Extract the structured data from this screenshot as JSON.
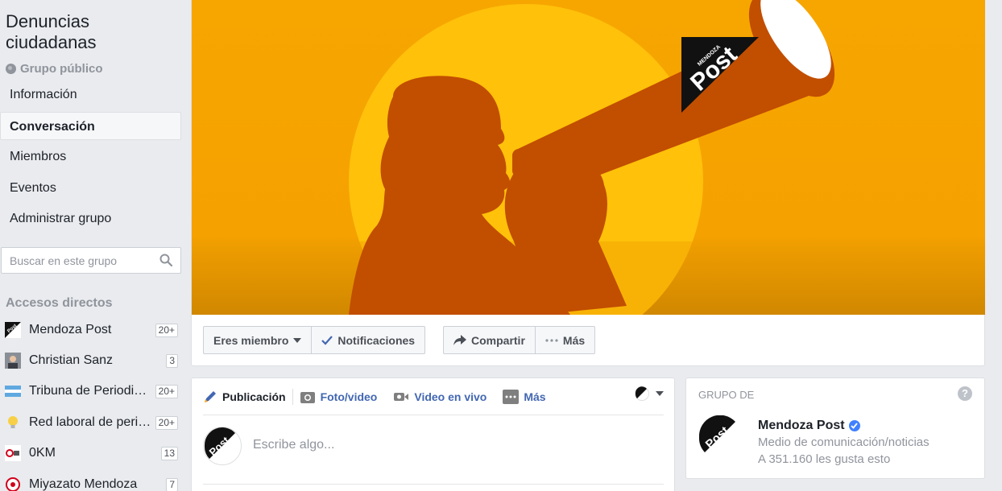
{
  "group": {
    "title": "Denuncias ciudadanas",
    "privacy": "Grupo público"
  },
  "nav": [
    {
      "label": "Información",
      "active": false
    },
    {
      "label": "Conversación",
      "active": true
    },
    {
      "label": "Miembros",
      "active": false
    },
    {
      "label": "Eventos",
      "active": false
    },
    {
      "label": "Administrar grupo",
      "active": false
    }
  ],
  "search": {
    "placeholder": "Buscar en este grupo"
  },
  "shortcuts": {
    "title": "Accesos directos",
    "items": [
      {
        "label": "Mendoza Post",
        "count": "20+",
        "icon": "mendoza-post-logo-icon"
      },
      {
        "label": "Christian Sanz",
        "count": "3",
        "icon": "profile-photo-icon"
      },
      {
        "label": "Tribuna de Periodistas",
        "count": "20+",
        "icon": "tribuna-logo-icon"
      },
      {
        "label": "Red laboral de periodistas",
        "count": "20+",
        "icon": "lightbulb-icon"
      },
      {
        "label": "0KM",
        "count": "13",
        "icon": "okm-logo-icon"
      },
      {
        "label": "Miyazato Mendoza",
        "count": "7",
        "icon": "miyazato-logo-icon"
      }
    ]
  },
  "cover": {
    "logo_line1": "MENDOZA",
    "logo_line2": "Post",
    "colors": {
      "bg": "#f5a100",
      "sun": "#ffc107",
      "silhouette": "#c24e00"
    }
  },
  "actions": {
    "member": "Eres miembro",
    "notifications": "Notificaciones",
    "share": "Compartir",
    "more": "Más"
  },
  "composer": {
    "tabs": [
      {
        "label": "Publicación",
        "icon": "pencil-icon"
      },
      {
        "label": "Foto/video",
        "icon": "camera-icon"
      },
      {
        "label": "Video en vivo",
        "icon": "live-video-icon"
      },
      {
        "label": "Más",
        "icon": "more-dots-icon"
      }
    ],
    "placeholder": "Escribe algo..."
  },
  "group_of": {
    "header": "GRUPO DE",
    "help": "?",
    "name": "Mendoza Post",
    "category": "Medio de comunicación/noticias",
    "likes": "A 351.160 les gusta esto"
  }
}
